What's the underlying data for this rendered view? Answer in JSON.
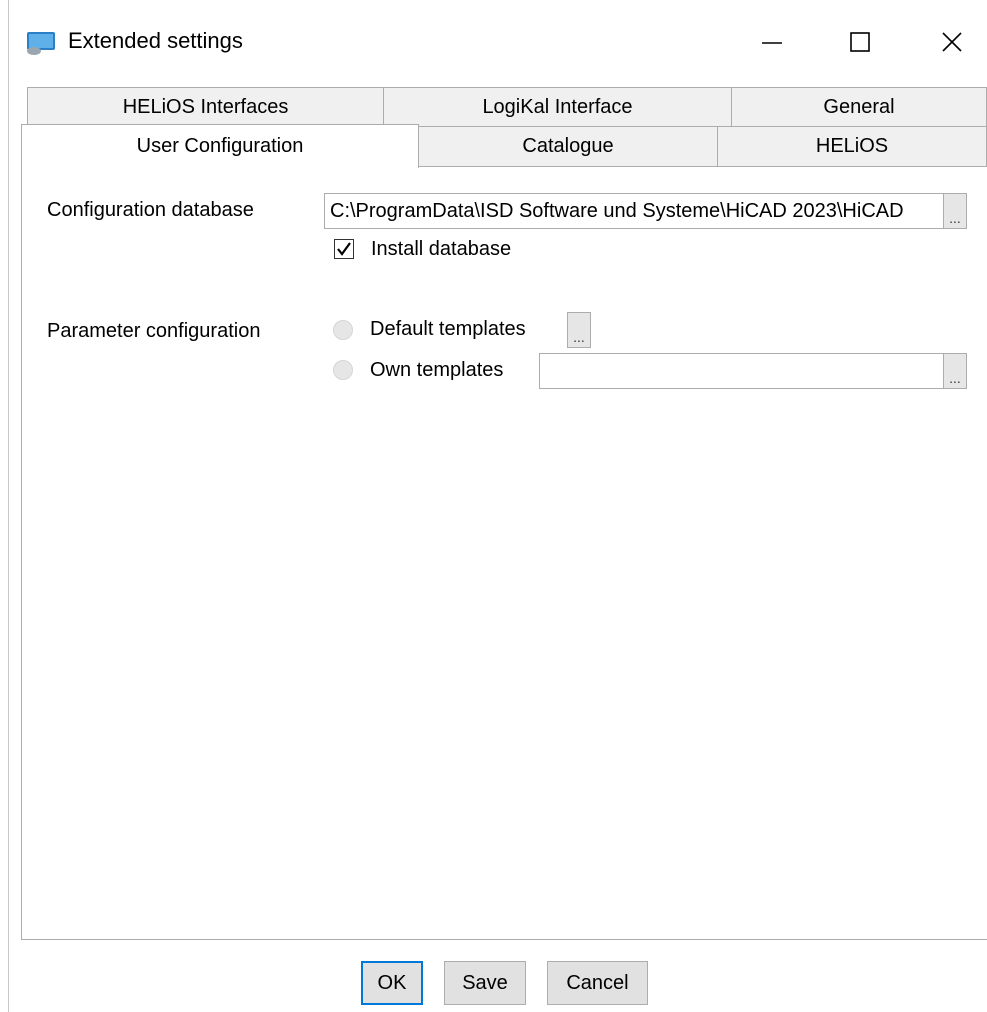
{
  "window": {
    "title": "Extended settings"
  },
  "tabs": {
    "row_back": [
      "HELiOS Interfaces",
      "LogiKal Interface",
      "General"
    ],
    "row_front": [
      "User Configuration",
      "Catalogue",
      "HELiOS"
    ],
    "active": "User Configuration"
  },
  "config_db": {
    "label": "Configuration database",
    "path": "C:\\ProgramData\\ISD Software und Systeme\\HiCAD 2023\\HiCAD",
    "browse": "...",
    "install_label": "Install database",
    "install_checked": true
  },
  "param_config": {
    "label": "Parameter configuration",
    "default_templates": "Default templates",
    "own_templates": "Own templates",
    "own_path": "",
    "browse": "..."
  },
  "buttons": {
    "ok": "OK",
    "save": "Save",
    "cancel": "Cancel"
  },
  "colors": {
    "accent": "#0078d7",
    "tab_bg": "#f0f0f0",
    "border": "#acacac"
  }
}
